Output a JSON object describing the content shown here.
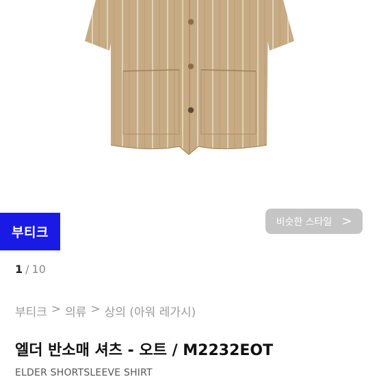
{
  "hero": {
    "brand_badge": "부티크",
    "similar_style_label": "비슷한 스타일",
    "similar_style_chevron": ">",
    "shirt_color": "#c4a982"
  },
  "pager": {
    "current": "1",
    "separator": "/",
    "total": "10"
  },
  "breadcrumb": {
    "items": [
      "부티크",
      "의류",
      "상의 (아워 레가시)"
    ],
    "separator": ">"
  },
  "product": {
    "title": "엘더 반소매 셔츠 - 오트 / M2232EOT",
    "subtitle": "ELDER SHORTSLEEVE SHIRT"
  },
  "colors": {
    "badge_blue": "#1a1ae6",
    "button_overlay": "#969696"
  }
}
